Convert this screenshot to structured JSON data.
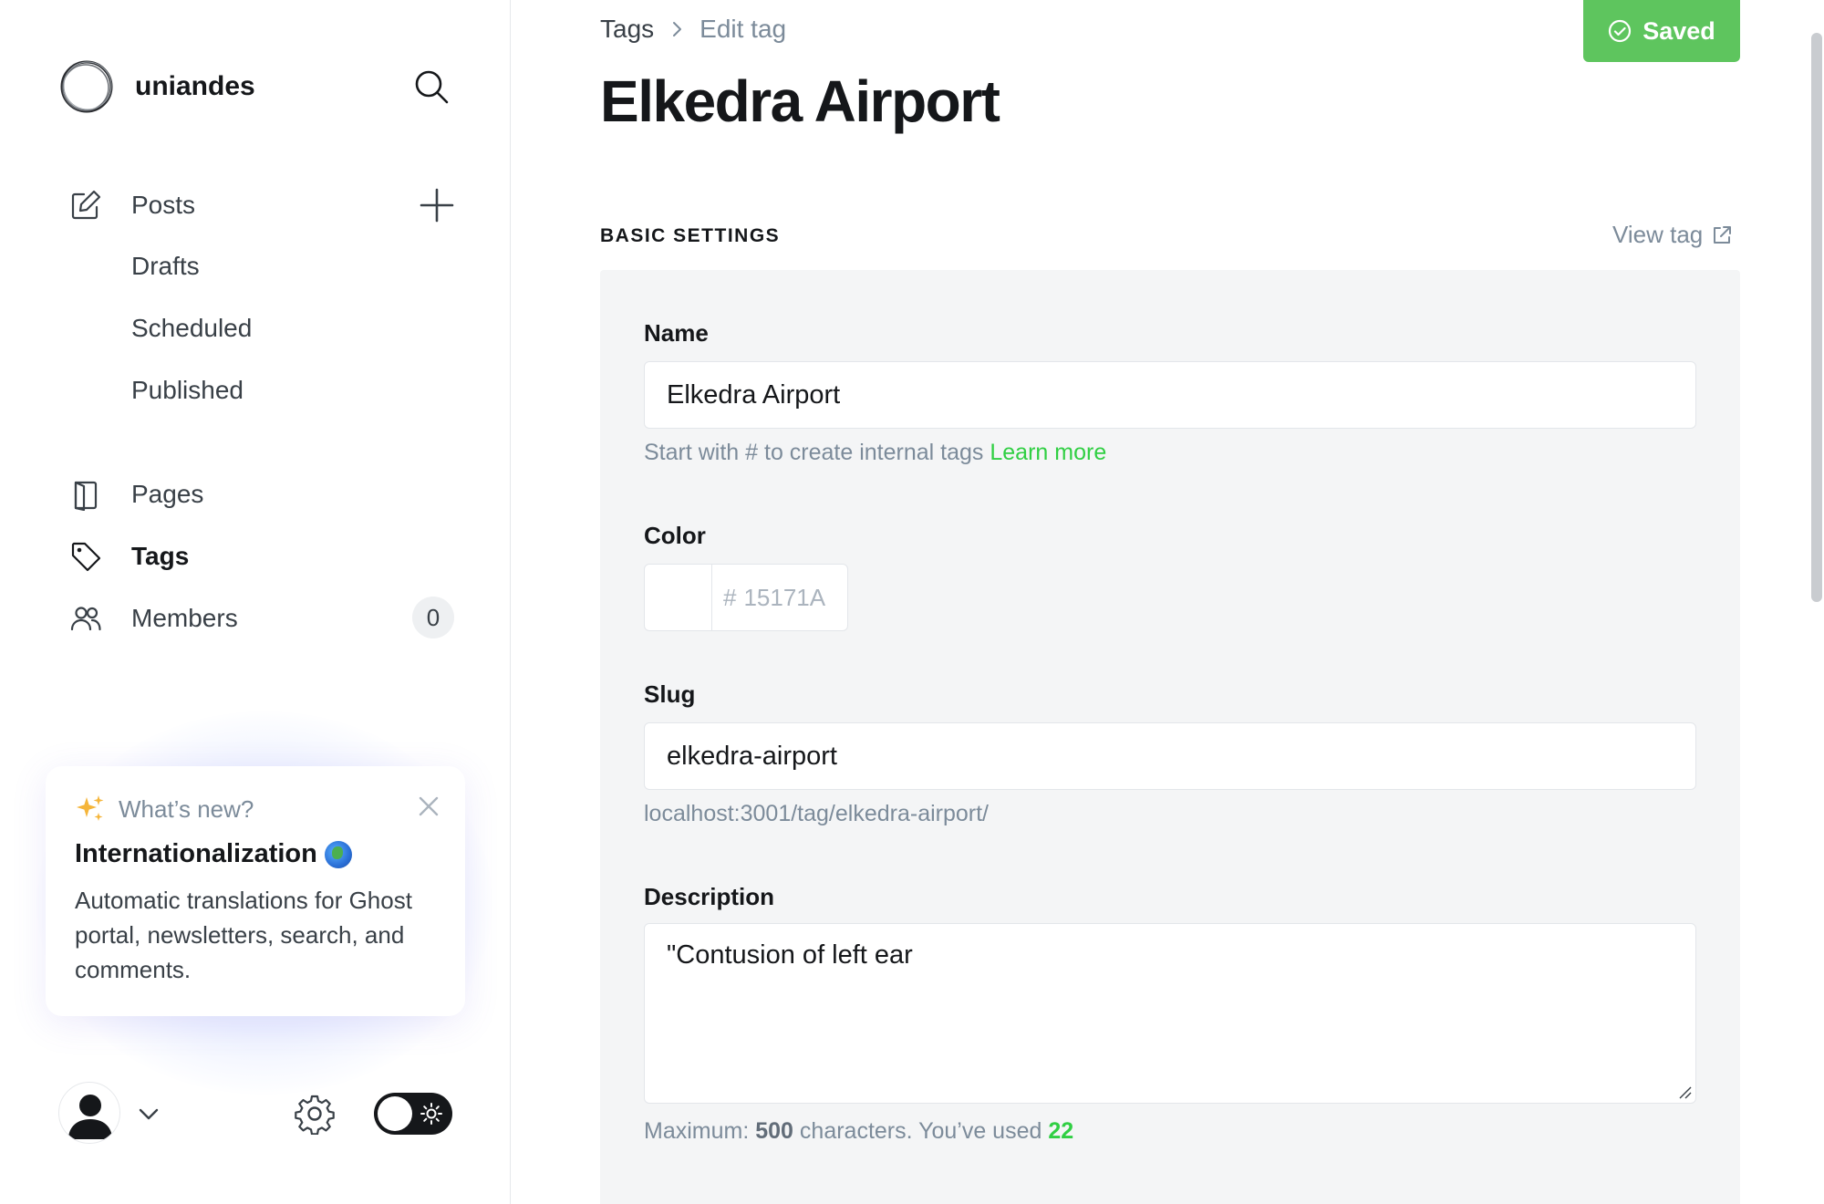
{
  "sidebar": {
    "brand": {
      "name": "uniandes"
    },
    "nav": {
      "posts": "Posts",
      "drafts": "Drafts",
      "scheduled": "Scheduled",
      "published": "Published",
      "pages": "Pages",
      "tags": "Tags",
      "members": "Members",
      "members_count": "0"
    },
    "whats_new": {
      "label": "What’s new?",
      "title": "Internationalization",
      "body": "Automatic translations for Ghost portal, newsletters, search, and comments."
    }
  },
  "header": {
    "breadcrumb_parent": "Tags",
    "breadcrumb_current": "Edit tag",
    "save_label": "Saved",
    "title": "Elkedra Airport"
  },
  "basic_settings": {
    "heading": "BASIC SETTINGS",
    "view_tag": "View tag",
    "name": {
      "label": "Name",
      "value": "Elkedra Airport",
      "hint": "Start with # to create internal tags",
      "learn_more": "Learn more"
    },
    "color": {
      "label": "Color",
      "hash": "#",
      "placeholder": "15171A"
    },
    "slug": {
      "label": "Slug",
      "value": "elkedra-airport",
      "url": "localhost:3001/tag/elkedra-airport/"
    },
    "description": {
      "label": "Description",
      "value": "\"Contusion of left ear",
      "max_prefix": "Maximum:",
      "max_value": "500",
      "max_suffix": "characters. You’ve used",
      "used": "22"
    }
  },
  "colors": {
    "accent_green": "#30cf43",
    "save_green": "#5ec55e",
    "text_dark": "#15171a",
    "text_muted": "#7c8b9a"
  }
}
